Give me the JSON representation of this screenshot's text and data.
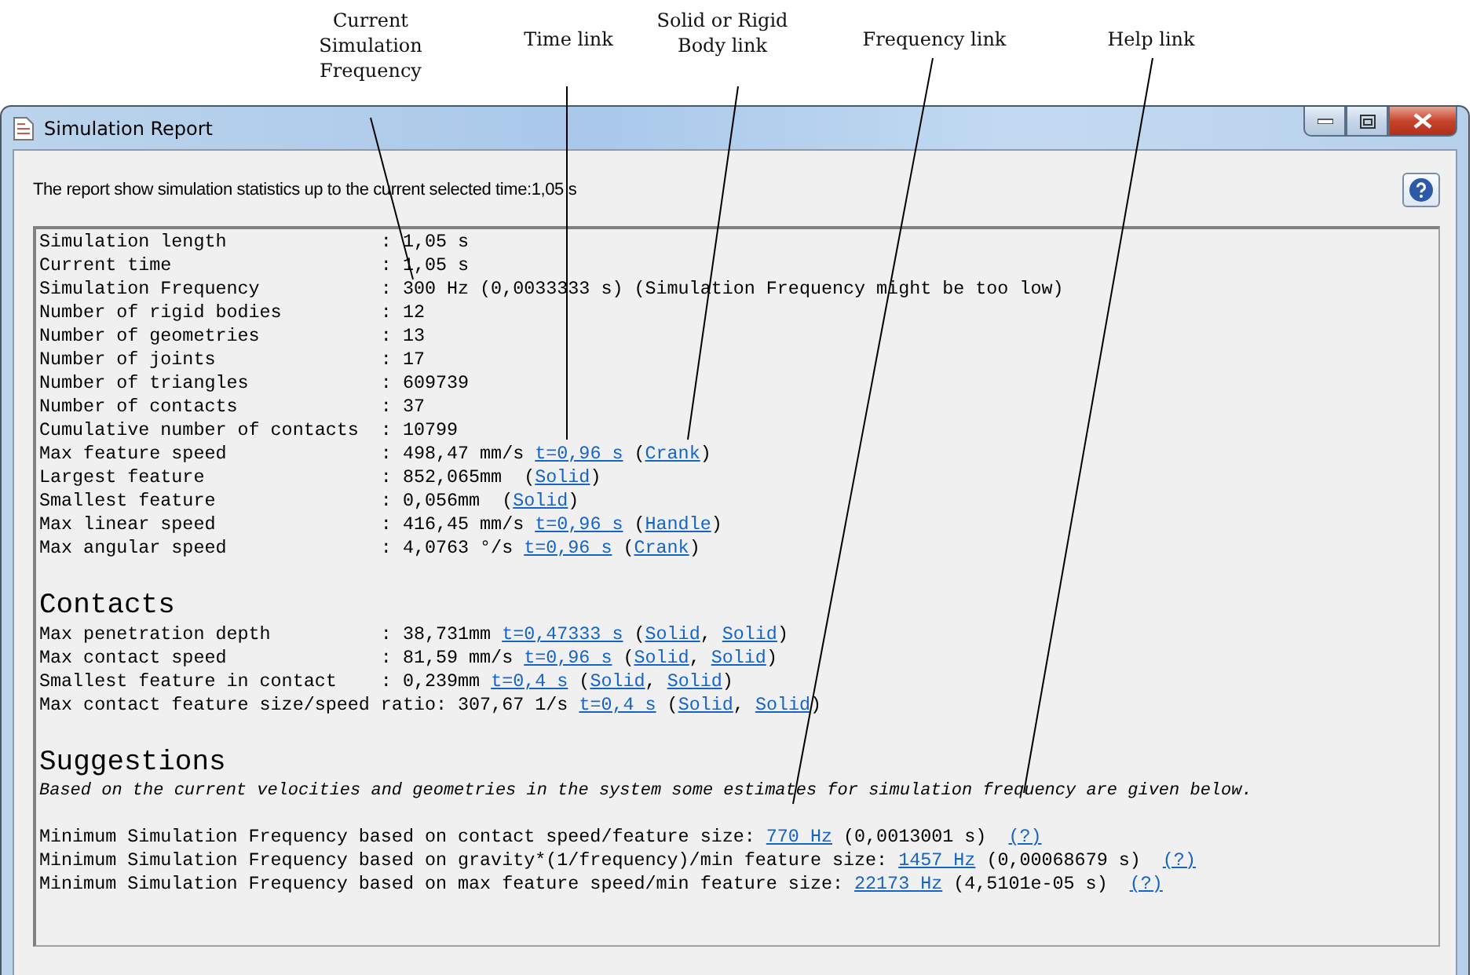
{
  "callouts": [
    {
      "text": "Current Simulation Frequency"
    },
    {
      "text": "Time link"
    },
    {
      "text": "Solid or Rigid Body link"
    },
    {
      "text": "Frequency link"
    },
    {
      "text": "Help link"
    }
  ],
  "window": {
    "title": "Simulation Report"
  },
  "description": "The report show simulation statistics up to the current selected time:1,05 s",
  "stats": [
    {
      "label": "Simulation length",
      "parts": [
        {
          "kind": "text",
          "text": ": 1,05 s"
        }
      ]
    },
    {
      "label": "Current time",
      "parts": [
        {
          "kind": "text",
          "text": ": 1,05 s"
        }
      ]
    },
    {
      "label": "Simulation Frequency",
      "parts": [
        {
          "kind": "text",
          "text": ": 300 Hz (0,0033333 s) (Simulation Frequency might be too low)"
        }
      ]
    },
    {
      "label": "Number of rigid bodies",
      "parts": [
        {
          "kind": "text",
          "text": ": 12"
        }
      ]
    },
    {
      "label": "Number of geometries",
      "parts": [
        {
          "kind": "text",
          "text": ": 13"
        }
      ]
    },
    {
      "label": "Number of joints",
      "parts": [
        {
          "kind": "text",
          "text": ": 17"
        }
      ]
    },
    {
      "label": "Number of triangles",
      "parts": [
        {
          "kind": "text",
          "text": ": 609739"
        }
      ]
    },
    {
      "label": "Number of contacts",
      "parts": [
        {
          "kind": "text",
          "text": ": 37"
        }
      ]
    },
    {
      "label": "Cumulative number of contacts",
      "parts": [
        {
          "kind": "text",
          "text": ": 10799"
        }
      ]
    },
    {
      "label": "Max feature speed",
      "parts": [
        {
          "kind": "text",
          "text": ": 498,47 mm/s "
        },
        {
          "kind": "link",
          "text": "t=0,96 s"
        },
        {
          "kind": "text",
          "text": " ("
        },
        {
          "kind": "link",
          "text": "Crank"
        },
        {
          "kind": "text",
          "text": ")"
        }
      ]
    },
    {
      "label": "Largest feature",
      "parts": [
        {
          "kind": "text",
          "text": ": 852,065mm  ("
        },
        {
          "kind": "link",
          "text": "Solid"
        },
        {
          "kind": "text",
          "text": ")"
        }
      ]
    },
    {
      "label": "Smallest feature",
      "parts": [
        {
          "kind": "text",
          "text": ": 0,056mm  ("
        },
        {
          "kind": "link",
          "text": "Solid"
        },
        {
          "kind": "text",
          "text": ")"
        }
      ]
    },
    {
      "label": "Max linear speed",
      "parts": [
        {
          "kind": "text",
          "text": ": 416,45 mm/s "
        },
        {
          "kind": "link",
          "text": "t=0,96 s"
        },
        {
          "kind": "text",
          "text": " ("
        },
        {
          "kind": "link",
          "text": "Handle"
        },
        {
          "kind": "text",
          "text": ")"
        }
      ]
    },
    {
      "label": "Max angular speed",
      "parts": [
        {
          "kind": "text",
          "text": ": 4,0763 °/s "
        },
        {
          "kind": "link",
          "text": "t=0,96 s"
        },
        {
          "kind": "text",
          "text": " ("
        },
        {
          "kind": "link",
          "text": "Crank"
        },
        {
          "kind": "text",
          "text": ")"
        }
      ]
    }
  ],
  "contacts": {
    "heading": "Contacts",
    "rows": [
      {
        "label": "Max penetration depth",
        "parts": [
          {
            "kind": "text",
            "text": ": 38,731mm "
          },
          {
            "kind": "link",
            "text": "t=0,47333 s"
          },
          {
            "kind": "text",
            "text": " ("
          },
          {
            "kind": "link",
            "text": "Solid"
          },
          {
            "kind": "text",
            "text": ", "
          },
          {
            "kind": "link",
            "text": "Solid"
          },
          {
            "kind": "text",
            "text": ")"
          }
        ]
      },
      {
        "label": "Max contact speed",
        "parts": [
          {
            "kind": "text",
            "text": ": 81,59 mm/s "
          },
          {
            "kind": "link",
            "text": "t=0,96 s"
          },
          {
            "kind": "text",
            "text": " ("
          },
          {
            "kind": "link",
            "text": "Solid"
          },
          {
            "kind": "text",
            "text": ", "
          },
          {
            "kind": "link",
            "text": "Solid"
          },
          {
            "kind": "text",
            "text": ")"
          }
        ]
      },
      {
        "label": "Smallest feature in contact",
        "parts": [
          {
            "kind": "text",
            "text": ": 0,239mm "
          },
          {
            "kind": "link",
            "text": "t=0,4 s"
          },
          {
            "kind": "text",
            "text": " ("
          },
          {
            "kind": "link",
            "text": "Solid"
          },
          {
            "kind": "text",
            "text": ", "
          },
          {
            "kind": "link",
            "text": "Solid"
          },
          {
            "kind": "text",
            "text": ")"
          }
        ]
      },
      {
        "label": "Max contact feature size/speed ratio",
        "parts": [
          {
            "kind": "text",
            "text": ": 307,67 1/s "
          },
          {
            "kind": "link",
            "text": "t=0,4 s"
          },
          {
            "kind": "text",
            "text": " ("
          },
          {
            "kind": "link",
            "text": "Solid"
          },
          {
            "kind": "text",
            "text": ", "
          },
          {
            "kind": "link",
            "text": "Solid"
          },
          {
            "kind": "text",
            "text": ")"
          }
        ]
      }
    ]
  },
  "suggestions": {
    "heading": "Suggestions",
    "note": "Based on the current velocities and geometries in the system some estimates for simulation frequency are given below.",
    "lines": [
      {
        "parts": [
          {
            "kind": "text",
            "text": "Minimum Simulation Frequency based on contact speed/feature size: "
          },
          {
            "kind": "link",
            "text": "770 Hz"
          },
          {
            "kind": "text",
            "text": " (0,0013001 s)  "
          },
          {
            "kind": "link",
            "text": "(?)"
          }
        ]
      },
      {
        "parts": [
          {
            "kind": "text",
            "text": "Minimum Simulation Frequency based on gravity*(1/frequency)/min feature size: "
          },
          {
            "kind": "link",
            "text": "1457 Hz"
          },
          {
            "kind": "text",
            "text": " (0,00068679 s)  "
          },
          {
            "kind": "link",
            "text": "(?)"
          }
        ]
      },
      {
        "parts": [
          {
            "kind": "text",
            "text": "Minimum Simulation Frequency based on max feature speed/min feature size: "
          },
          {
            "kind": "link",
            "text": "22173 Hz"
          },
          {
            "kind": "text",
            "text": " (4,5101e-05 s)  "
          },
          {
            "kind": "link",
            "text": "(?)"
          }
        ]
      }
    ]
  }
}
